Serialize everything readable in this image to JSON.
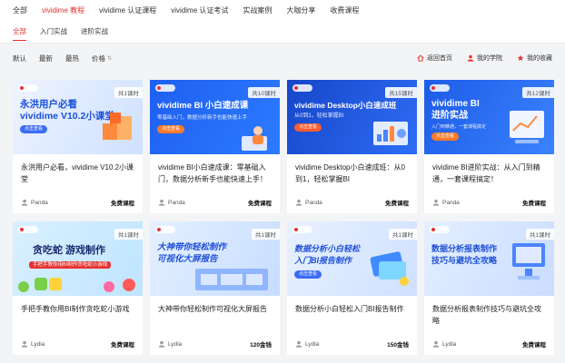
{
  "top_nav": [
    "全部",
    "vividime 教程",
    "vividime 认证课程",
    "vividime 认证考试",
    "实战案例",
    "大咖分享",
    "收费课程"
  ],
  "top_nav_active": 1,
  "sub_nav": [
    "全部",
    "入门实战",
    "进阶实战"
  ],
  "sub_nav_active": 0,
  "sort": [
    "默认",
    "最新",
    "最热",
    "价格"
  ],
  "links": {
    "home": "返回首页",
    "my_school": "我的学院",
    "my_fav": "我的收藏"
  },
  "colors": {
    "accent": "#e8312f"
  },
  "courses": [
    {
      "lessons": "共1课时",
      "thumb": {
        "headline": "永洪用户必看\nvividime V10.2小课堂",
        "subtitle": "",
        "button": "点击查看"
      },
      "title": "永洪用户必看，vividime V10.2小课堂",
      "author": "Panda",
      "price": "免费课程"
    },
    {
      "lessons": "共10课时",
      "thumb": {
        "headline": "vividime BI 小白速成课",
        "subtitle": "零基础入门，数据分析新手也能快速上手",
        "button": "点击查看"
      },
      "title": "vividime BI小白速成课：零基础入门，数据分析新手也能快速上手！",
      "author": "Panda",
      "price": "免费课程"
    },
    {
      "lessons": "共15课时",
      "thumb": {
        "headline": "vividime Desktop小白速成班",
        "subtitle": "从0到1，轻松掌握BI",
        "button": "点击查看"
      },
      "title": "vividime Desktop小白速成班：从0到1，轻松掌握BI",
      "author": "Panda",
      "price": "免费课程"
    },
    {
      "lessons": "共12课时",
      "thumb": {
        "headline": "vividime BI\n进阶实战",
        "subtitle": "入门到精通，一套课程搞定",
        "button": "点击查看"
      },
      "title": "vividime BI进阶实战：从入门到精通，一套课程搞定！",
      "author": "Panda",
      "price": "免费课程"
    },
    {
      "lessons": "共1课时",
      "thumb": {
        "headline": "贪吃蛇 游戏制作",
        "subtitle": "手把手教你用BI制作贪吃蛇小游戏",
        "button": ""
      },
      "title": "手把手教你用BI制作贪吃蛇小游戏",
      "author": "Lydia",
      "price": "免费课程"
    },
    {
      "lessons": "共1课时",
      "thumb": {
        "headline": "大神带你轻松制作\n可视化大屏报告",
        "subtitle": "",
        "button": ""
      },
      "title": "大神带你轻松制作可视化大屏报告",
      "author": "Lydia",
      "price": "120金钱"
    },
    {
      "lessons": "共1课时",
      "thumb": {
        "headline": "数据分析小白轻松\n入门BI报告制作",
        "subtitle": "",
        "button": "点击查看"
      },
      "title": "数据分析小白轻松入门BI报告制作",
      "author": "Lydia",
      "price": "150金钱"
    },
    {
      "lessons": "共1课时",
      "thumb": {
        "headline": "数据分析报表制作\n技巧与避坑全攻略",
        "subtitle": "",
        "button": ""
      },
      "title": "数据分析报表制作技巧与避坑全攻略",
      "author": "Lydia",
      "price": "免费课程"
    }
  ]
}
